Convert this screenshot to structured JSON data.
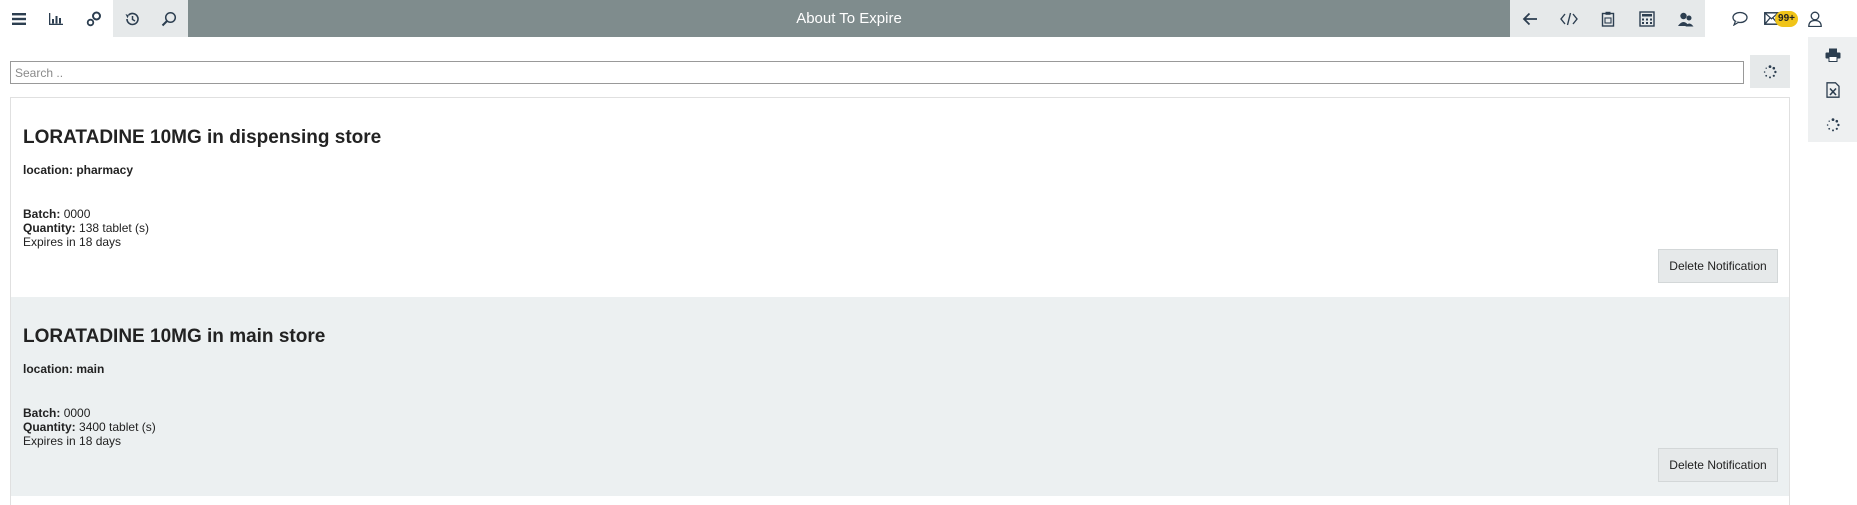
{
  "header": {
    "title": "About To Expire",
    "left_icons": [
      "menu-icon",
      "bar-chart-icon",
      "settings-icon",
      "history-icon",
      "search-icon"
    ],
    "right_icons": [
      "back-arrow-icon",
      "code-icon",
      "clipboard-icon",
      "calculator-icon",
      "users-icon"
    ],
    "far_icons": [
      "chat-icon",
      "mail-icon",
      "user-icon"
    ],
    "mail_badge": "99+"
  },
  "search": {
    "placeholder": "Search ..",
    "value": ""
  },
  "side_tools": [
    "print-icon",
    "excel-export-icon",
    "loading-icon"
  ],
  "notifications": [
    {
      "title": "LORATADINE 10MG in dispensing store",
      "location": "location: pharmacy",
      "batch_label": "Batch:",
      "batch": "0000",
      "quantity_label": "Quantity:",
      "quantity": "138 tablet (s)",
      "expires": "Expires in 18 days",
      "delete_label": "Delete Notification"
    },
    {
      "title": "LORATADINE 10MG in main store",
      "location": "location: main",
      "batch_label": "Batch:",
      "batch": "0000",
      "quantity_label": "Quantity:",
      "quantity": "3400 tablet (s)",
      "expires": "Expires in 18 days",
      "delete_label": "Delete Notification"
    }
  ],
  "colors": {
    "title_bar": "#7f8c8d",
    "button_bg": "#e6e9ea",
    "alt_row_bg": "#ecf0f1",
    "badge": "#f0c419"
  }
}
